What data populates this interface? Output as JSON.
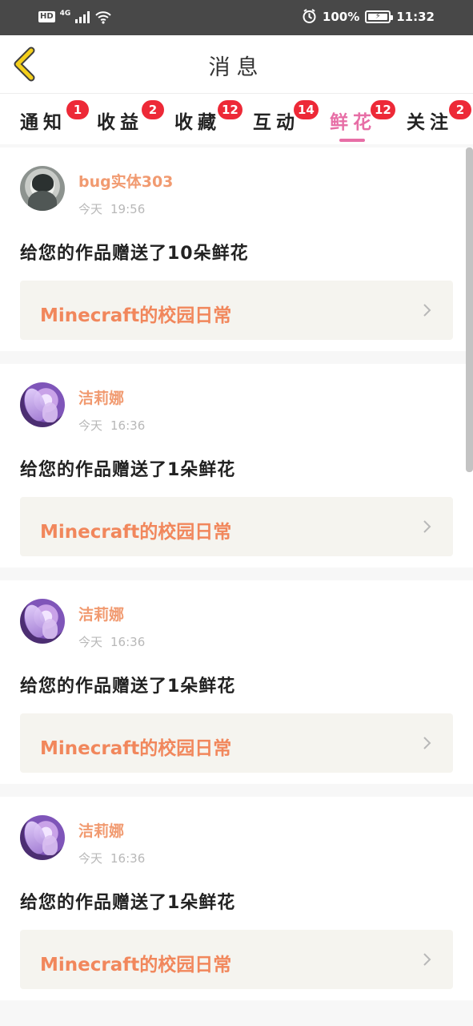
{
  "status_bar": {
    "hd": "HD",
    "network": "4G",
    "battery_percent": "100%",
    "time": "11:32"
  },
  "header": {
    "title": "消息"
  },
  "tabs": [
    {
      "label": "通知",
      "badge": "1"
    },
    {
      "label": "收益",
      "badge": "2"
    },
    {
      "label": "收藏",
      "badge": "12"
    },
    {
      "label": "互动",
      "badge": "14"
    },
    {
      "label": "鲜花",
      "badge": "12",
      "active": true
    },
    {
      "label": "关注",
      "badge": "2"
    }
  ],
  "messages": [
    {
      "username": "bug实体303",
      "day": "今天",
      "time": "19:56",
      "message": "给您的作品赠送了10朵鲜花",
      "work_title": "Minecraft的校园日常"
    },
    {
      "username": "洁莉娜",
      "day": "今天",
      "time": "16:36",
      "message": "给您的作品赠送了1朵鲜花",
      "work_title": "Minecraft的校园日常"
    },
    {
      "username": "洁莉娜",
      "day": "今天",
      "time": "16:36",
      "message": "给您的作品赠送了1朵鲜花",
      "work_title": "Minecraft的校园日常"
    },
    {
      "username": "洁莉娜",
      "day": "今天",
      "time": "16:36",
      "message": "给您的作品赠送了1朵鲜花",
      "work_title": "Minecraft的校园日常"
    }
  ],
  "colors": {
    "status_bar": "#484848",
    "active_tab": "#e76ea6",
    "badge": "#ed2937",
    "username": "#f19a70",
    "work_title": "#f1875c",
    "card_link_bg": "#f5f4ef",
    "back_icon": "#f4cf1b"
  }
}
